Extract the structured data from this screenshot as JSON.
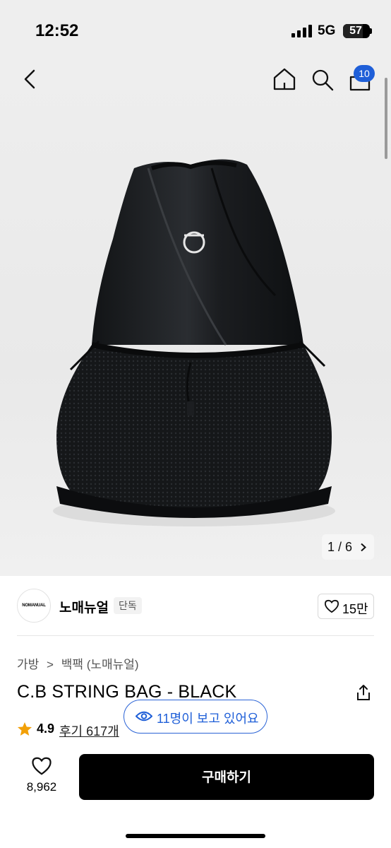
{
  "status_bar": {
    "time": "12:52",
    "network": "5G",
    "battery": "57"
  },
  "header": {
    "cart_count": "10"
  },
  "gallery": {
    "counter": "1 / 6"
  },
  "brand": {
    "logo_text": "NOMANUAL",
    "name": "노매뉴얼",
    "tag": "단독",
    "like_count": "15만"
  },
  "breadcrumb": {
    "category": "가방",
    "separator": ">",
    "subcategory": "백팩 (노매뉴얼)"
  },
  "product": {
    "title": "C.B STRING BAG - BLACK",
    "rating": "4.9",
    "reviews": "후기 617개"
  },
  "viewers": {
    "text": "11명이 보고 있어요"
  },
  "bottom_bar": {
    "wish_count": "8,962",
    "buy_label": "구매하기"
  },
  "colors": {
    "accent": "#1f5fd8",
    "star": "#f2a007",
    "buy_button": "#000000"
  },
  "icons": [
    "back-arrow-icon",
    "home-icon",
    "search-icon",
    "cart-icon",
    "chevron-right-icon",
    "heart-icon",
    "share-icon",
    "star-icon",
    "eye-icon"
  ]
}
